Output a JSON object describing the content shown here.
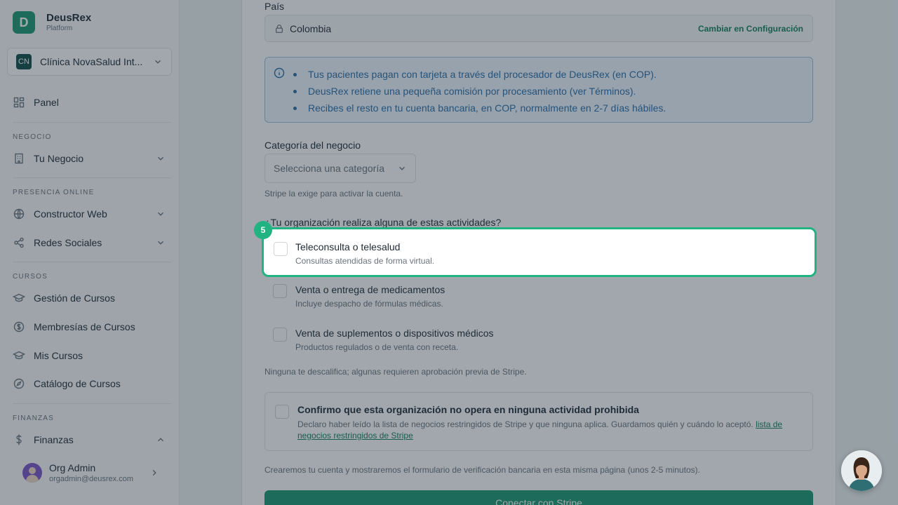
{
  "brand": {
    "initial": "D",
    "name": "DeusRex",
    "sub": "Platform"
  },
  "org": {
    "initials": "CN",
    "name": "Clínica NovaSalud Int..."
  },
  "nav": {
    "panel": "Panel",
    "sections": {
      "business": "NEGOCIO",
      "online": "PRESENCIA ONLINE",
      "courses": "CURSOS",
      "finance": "FINANZAS"
    },
    "tu_negocio": "Tu Negocio",
    "constructor_web": "Constructor Web",
    "redes_sociales": "Redes Sociales",
    "gestion_cursos": "Gestión de Cursos",
    "membresias": "Membresías de Cursos",
    "mis_cursos": "Mis Cursos",
    "catalogo": "Catálogo de Cursos",
    "finanzas": "Finanzas"
  },
  "user": {
    "name": "Org Admin",
    "email": "orgadmin@deusrex.com"
  },
  "form": {
    "country_label": "País",
    "country_value": "Colombia",
    "country_link": "Cambiar en Configuración",
    "info_items": [
      "Tus pacientes pagan con tarjeta a través del procesador de DeusRex (en COP).",
      "DeusRex retiene una pequeña comisión por procesamiento (ver Términos).",
      "Recibes el resto en tu cuenta bancaria, en COP, normalmente en 2-7 días hábiles."
    ],
    "category_label": "Categoría del negocio",
    "category_placeholder": "Selecciona una categoría",
    "category_help": "Stripe la exige para activar la cuenta.",
    "activities_label": "¿Tu organización realiza alguna de estas actividades?",
    "activities": [
      {
        "title": "Teleconsulta o telesalud",
        "desc": "Consultas atendidas de forma virtual."
      },
      {
        "title": "Venta o entrega de medicamentos",
        "desc": "Incluye despacho de fórmulas médicas."
      },
      {
        "title": "Venta de suplementos o dispositivos médicos",
        "desc": "Productos regulados o de venta con receta."
      }
    ],
    "activities_help": "Ninguna te descalifica; algunas requieren aprobación previa de Stripe.",
    "confirm_title": "Confirmo que esta organización no opera en ninguna actividad prohibida",
    "confirm_desc": "Declaro haber leído la lista de negocios restringidos de Stripe y que ninguna aplica. Guardamos quién y cuándo lo aceptó. ",
    "confirm_link": "lista de negocios restringidos de Stripe",
    "footer_note": "Crearemos tu cuenta y mostraremos el formulario de verificación bancaria en esta misma página (unos 2-5 minutos).",
    "cta": "Conectar con Stripe"
  },
  "tour": {
    "step": "5"
  },
  "colors": {
    "accent": "#1c9a72",
    "highlight": "#22b383",
    "info": "#2a6ea9"
  }
}
